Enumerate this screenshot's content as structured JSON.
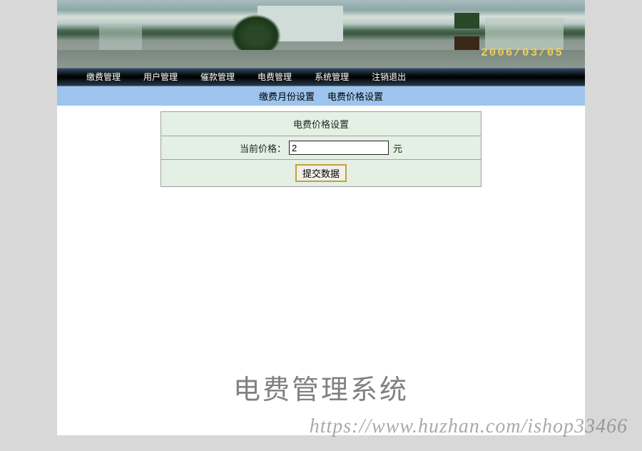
{
  "banner": {
    "date_stamp": "2006/03/05"
  },
  "navbar": {
    "items": [
      {
        "label": "缴费管理"
      },
      {
        "label": "用户管理"
      },
      {
        "label": "催款管理"
      },
      {
        "label": "电费管理"
      },
      {
        "label": "系统管理"
      },
      {
        "label": "注销退出"
      }
    ]
  },
  "subnav": {
    "items": [
      {
        "label": "缴费月份设置"
      },
      {
        "label": "电费价格设置"
      }
    ]
  },
  "form": {
    "title": "电费价格设置",
    "price_label": "当前价格：",
    "price_value": "2",
    "price_unit": "元",
    "submit_label": "提交数据"
  },
  "footer": {
    "system_title": "电费管理系统"
  },
  "watermark": "https://www.huzhan.com/ishop33466"
}
